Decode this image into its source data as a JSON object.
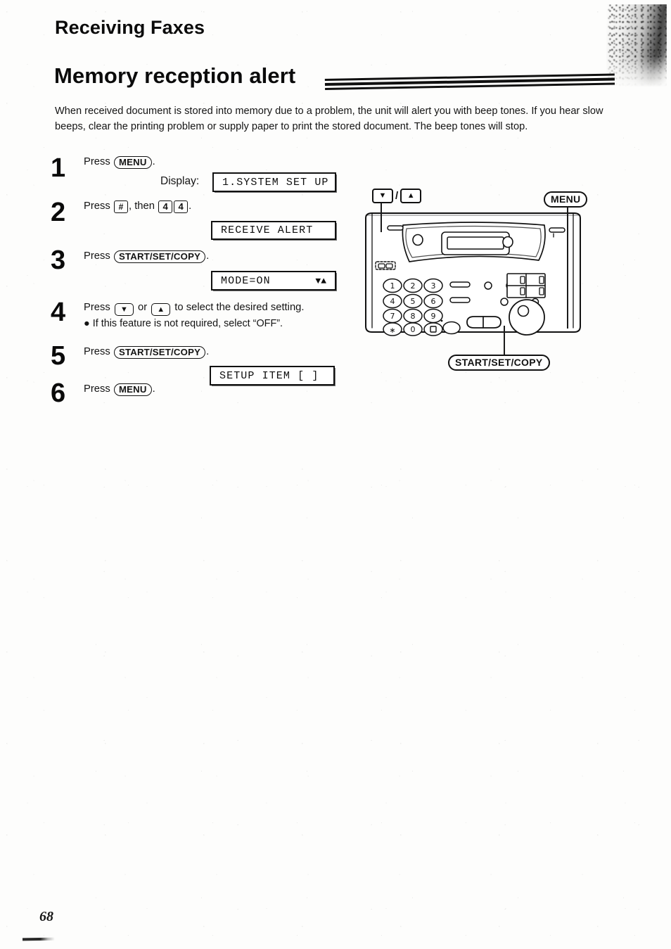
{
  "document": {
    "section_heading": "Receiving Faxes",
    "title": "Memory reception alert",
    "intro": "When received document is stored into memory due to a problem, the unit will alert you with beep tones. If you hear slow beeps, clear the printing problem or supply paper to print the stored document. The beep tones will stop.",
    "page_number": "68"
  },
  "labels": {
    "display_label": "Display:"
  },
  "steps": [
    {
      "number": "1",
      "press_word": "Press",
      "keys": [
        "MENU"
      ],
      "suffix": ".",
      "text_plain": "Press MENU ."
    },
    {
      "number": "2",
      "press_word": "Press",
      "keys": [
        "#",
        "4",
        "4"
      ],
      "then_word": "then",
      "text_plain": "Press # , then 4 4 ."
    },
    {
      "number": "3",
      "press_word": "Press",
      "keys": [
        "START/SET/COPY"
      ],
      "suffix": ".",
      "text_plain": "Press START/SET/COPY ."
    },
    {
      "number": "4",
      "press_word": "Press",
      "keys": [
        "▼",
        "▲"
      ],
      "or_word": "or",
      "tail": "to select the desired setting.",
      "bullet": "If this feature is not required, select “OFF”.",
      "text_plain": "Press ▼ or ▲ to select the desired setting."
    },
    {
      "number": "5",
      "press_word": "Press",
      "keys": [
        "START/SET/COPY"
      ],
      "suffix": ".",
      "text_plain": "Press START/SET/COPY ."
    },
    {
      "number": "6",
      "press_word": "Press",
      "keys": [
        "MENU"
      ],
      "suffix": ".",
      "text_plain": "Press MENU ."
    }
  ],
  "displays": [
    {
      "left": "1.SYSTEM SET UP",
      "right": ""
    },
    {
      "left": "RECEIVE ALERT",
      "right": ""
    },
    {
      "left": "MODE=ON",
      "right": "▼▲"
    },
    {
      "left": "SETUP ITEM [   ]",
      "right": ""
    }
  ],
  "diagram": {
    "callout_updown_down": "▼",
    "callout_updown_sep": "/",
    "callout_updown_up": "▲",
    "callout_menu": "MENU",
    "callout_start": "START/SET/COPY",
    "keypad": [
      [
        "1",
        "2",
        "3"
      ],
      [
        "4",
        "5",
        "6"
      ],
      [
        "7",
        "8",
        "9"
      ],
      [
        "∗",
        "0",
        "□"
      ]
    ]
  }
}
